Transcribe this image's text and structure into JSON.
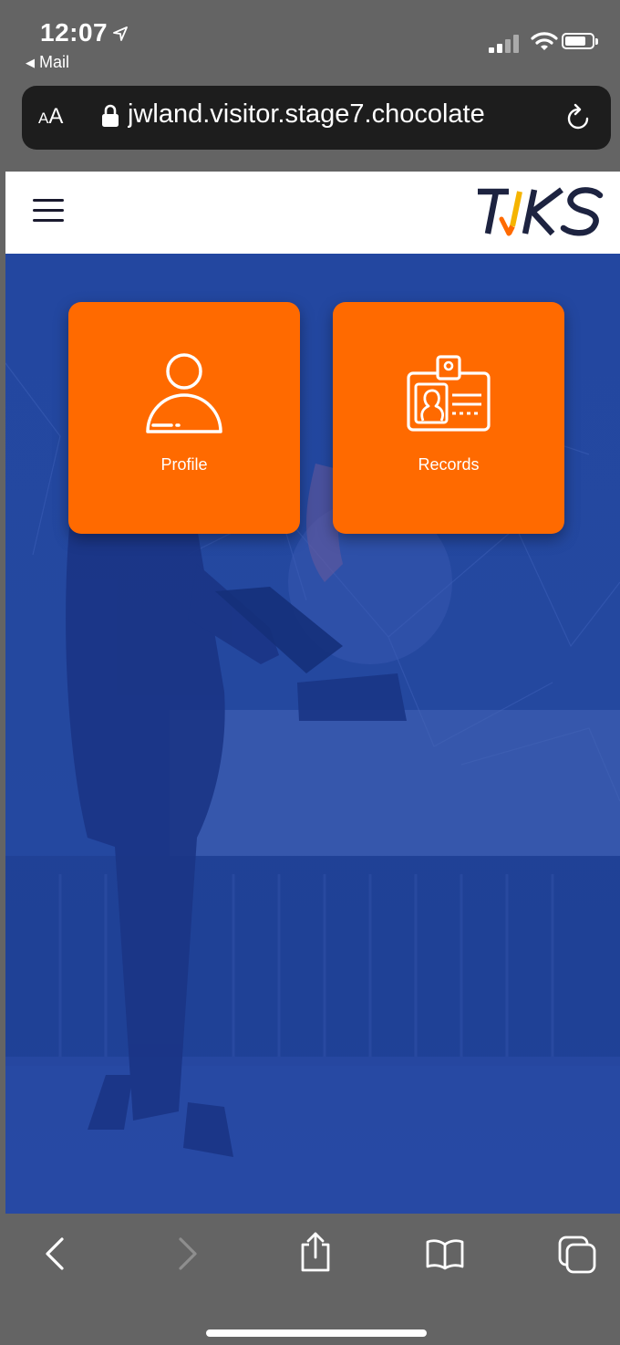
{
  "status_bar": {
    "time": "12:07",
    "back_label": "Mail"
  },
  "address_bar": {
    "text_size_small": "A",
    "text_size_large": "A",
    "url": "jwland.visitor.stage7.chocolate"
  },
  "site": {
    "logo": "TJKS",
    "brand_colors": {
      "navy": "#1d2340",
      "accent_orange": "#ff6a00",
      "accent_yellow": "#f5b400",
      "hero_blue": "#2347a0"
    }
  },
  "tiles": [
    {
      "label": "Profile",
      "icon": "person-icon"
    },
    {
      "label": "Records",
      "icon": "id-card-icon"
    }
  ],
  "toolbar": {
    "icons": [
      "back-icon",
      "forward-icon",
      "share-icon",
      "bookmarks-icon",
      "tabs-icon"
    ]
  }
}
